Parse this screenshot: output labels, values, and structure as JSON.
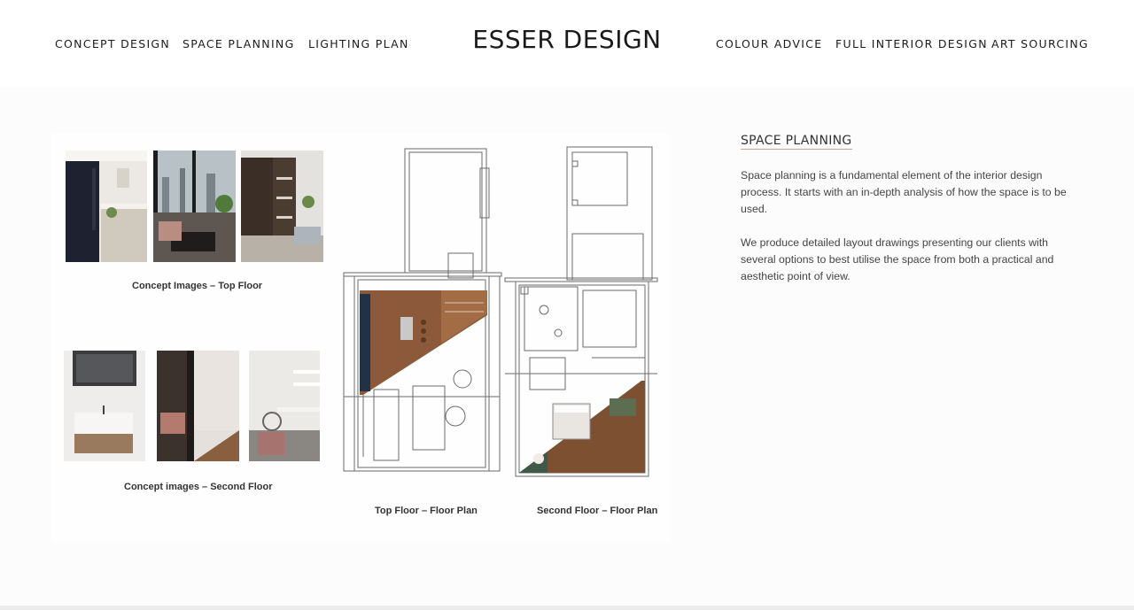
{
  "nav": {
    "left": [
      "CONCEPT DESIGN",
      "SPACE PLANNING",
      "LIGHTING PLAN"
    ],
    "right": [
      "COLOUR ADVICE",
      "FULL INTERIOR DESIGN",
      "ART SOURCING"
    ],
    "logo": "ESSER DESIGN"
  },
  "board": {
    "caption_top_floor_images": "Concept Images – Top Floor",
    "caption_second_floor_images": "Concept images – Second Floor",
    "caption_top_floor_plan": "Top Floor – Floor Plan",
    "caption_second_floor_plan": "Second Floor – Floor Plan"
  },
  "info": {
    "title": "SPACE PLANNING",
    "paragraph_1": "Space planning is a fundamental element of the interior design process. It starts with an in-depth analysis of how the space is to be used.",
    "paragraph_2": "We produce detailed layout drawings presenting our clients with several options to best utilise the space from both a practical and aesthetic point of view."
  },
  "colors": {
    "accent_underline": "#c9a48f",
    "section_background": "#fcfcfc"
  }
}
